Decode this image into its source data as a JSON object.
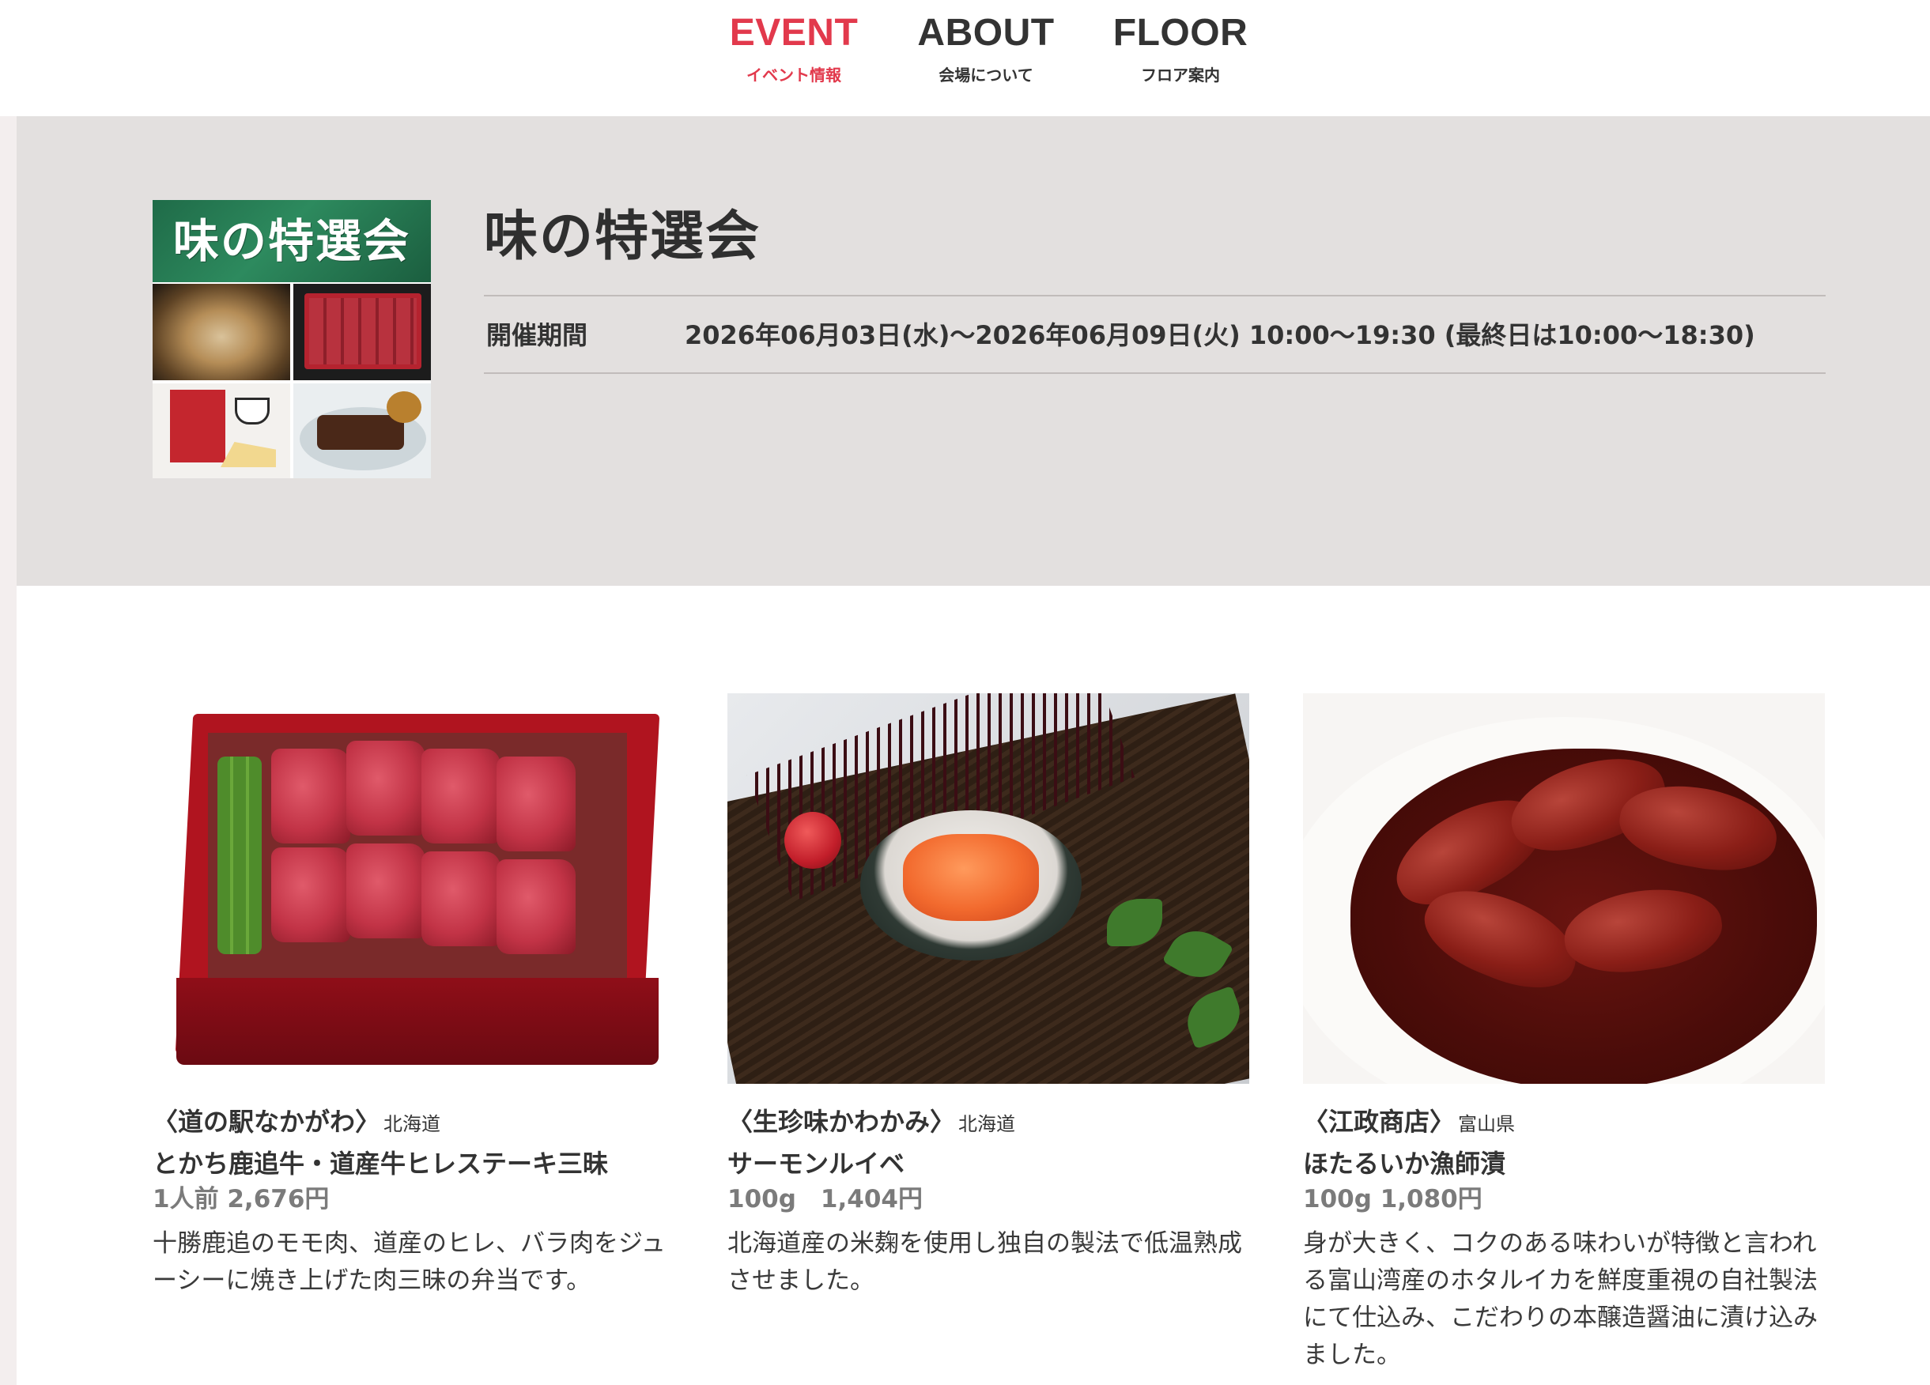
{
  "nav": {
    "items": [
      {
        "en": "EVENT",
        "jp": "イベント情報",
        "active": true
      },
      {
        "en": "ABOUT",
        "jp": "会場について",
        "active": false
      },
      {
        "en": "FLOOR",
        "jp": "フロア案内",
        "active": false
      }
    ]
  },
  "event": {
    "poster_title": "味の特選会",
    "title": "味の特選会",
    "period_label": "開催期間",
    "period_value": "2026年06月03日(水)〜2026年06月09日(火) 10:00〜19:30 (最終日は10:00〜18:30)"
  },
  "products": [
    {
      "shop": "〈道の駅なかがわ〉",
      "prefecture": "北海道",
      "name": "とかち鹿追牛・道産牛ヒレステーキ三昧",
      "price": "1人前 2,676円",
      "description": "十勝鹿追のモモ肉、道産のヒレ、バラ肉をジューシーに焼き上げた肉三昧の弁当です。"
    },
    {
      "shop": "〈生珍味かわかみ〉",
      "prefecture": "北海道",
      "name": "サーモンルイベ",
      "price": "100g　1,404円",
      "description": "北海道産の米麹を使用し独自の製法で低温熟成させました。"
    },
    {
      "shop": "〈江政商店〉",
      "prefecture": "富山県",
      "name": "ほたるいか漁師漬",
      "price": "100g 1,080円",
      "description": "身が大きく、コクのある味わいが特徴と言われる富山湾産のホタルイカを鮮度重視の自社製法にて仕込み、こだわりの本醸造醤油に漬け込みました。"
    }
  ],
  "colors": {
    "accent": "#e2394c",
    "band": "#e3e0df",
    "text": "#333333",
    "price": "#7b7b7b"
  }
}
